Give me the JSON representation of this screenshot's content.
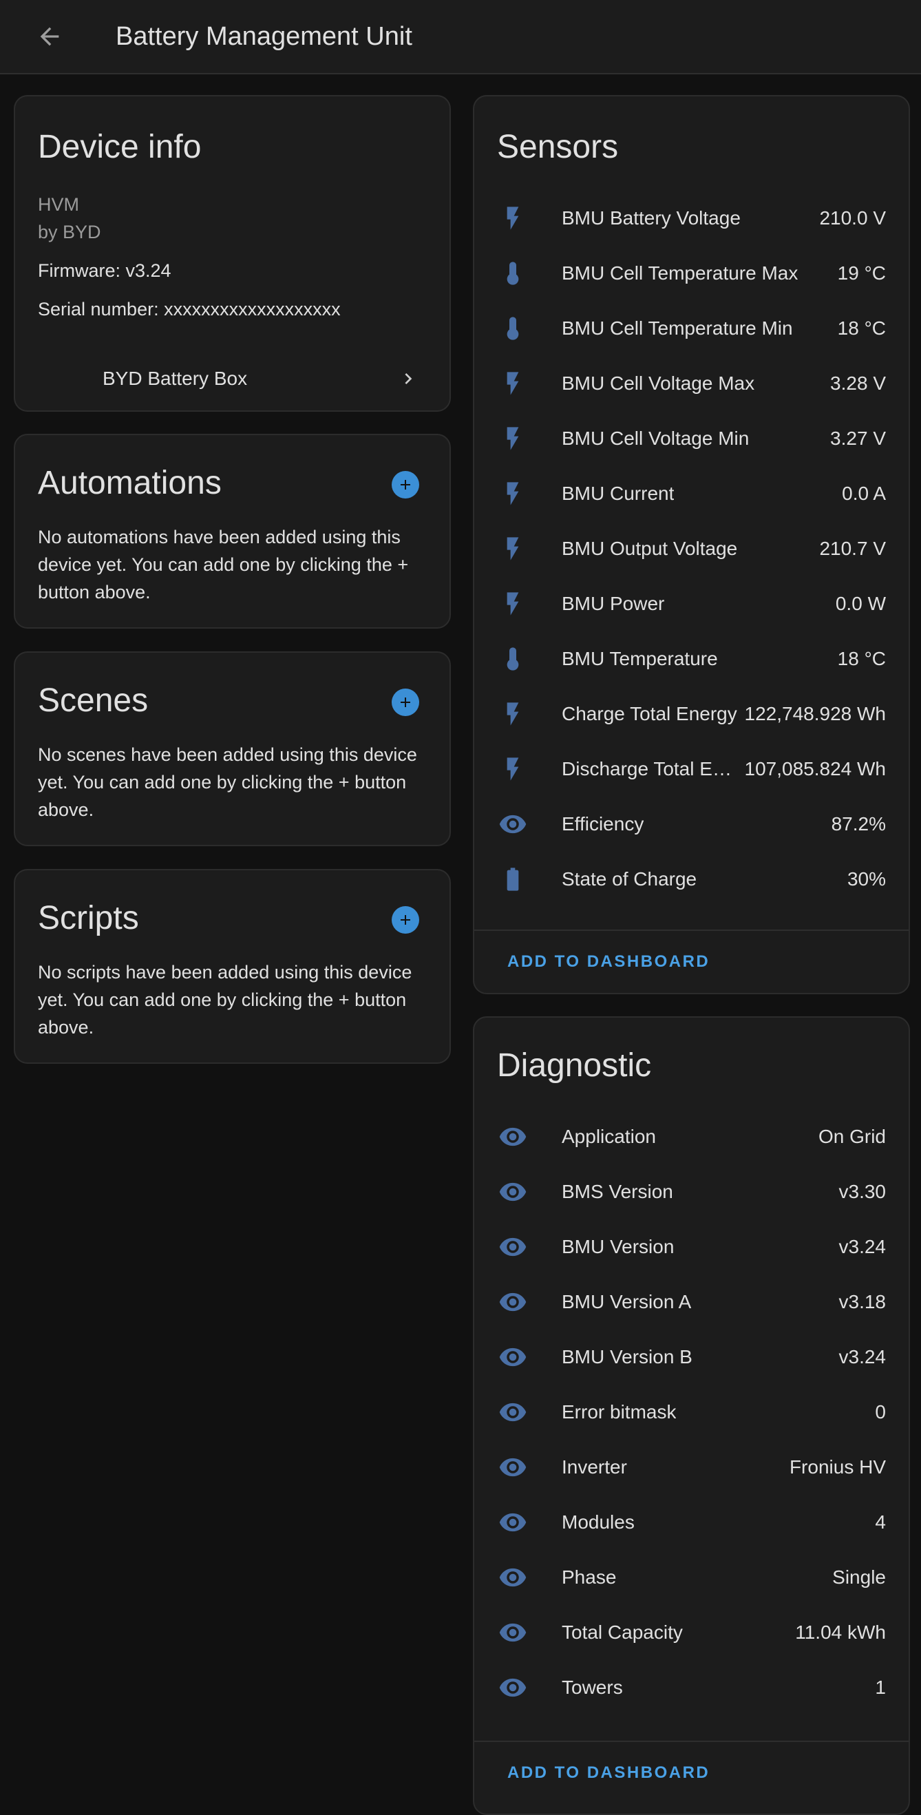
{
  "header": {
    "title": "Battery Management Unit"
  },
  "device_info": {
    "title": "Device info",
    "model": "HVM",
    "manufacturer": "by BYD",
    "firmware": "Firmware: v3.24",
    "serial": "Serial number: xxxxxxxxxxxxxxxxxxx",
    "link_label": "BYD Battery Box"
  },
  "automations": {
    "title": "Automations",
    "empty_text": "No automations have been added using this device yet. You can add one by clicking the + button above."
  },
  "scenes": {
    "title": "Scenes",
    "empty_text": "No scenes have been added using this device yet. You can add one by clicking the + button above."
  },
  "scripts": {
    "title": "Scripts",
    "empty_text": "No scripts have been added using this device yet. You can add one by clicking the + button above."
  },
  "sensors": {
    "title": "Sensors",
    "add_label": "ADD TO DASHBOARD",
    "items": [
      {
        "icon": "flash-icon",
        "name": "BMU Battery Voltage",
        "value": "210.0 V"
      },
      {
        "icon": "thermometer-icon",
        "name": "BMU Cell Temperature Max",
        "value": "19 °C"
      },
      {
        "icon": "thermometer-icon",
        "name": "BMU Cell Temperature Min",
        "value": "18 °C"
      },
      {
        "icon": "flash-icon",
        "name": "BMU Cell Voltage Max",
        "value": "3.28 V"
      },
      {
        "icon": "flash-icon",
        "name": "BMU Cell Voltage Min",
        "value": "3.27 V"
      },
      {
        "icon": "flash-icon",
        "name": "BMU Current",
        "value": "0.0 A"
      },
      {
        "icon": "flash-icon",
        "name": "BMU Output Voltage",
        "value": "210.7 V"
      },
      {
        "icon": "flash-icon",
        "name": "BMU Power",
        "value": "0.0 W"
      },
      {
        "icon": "thermometer-icon",
        "name": "BMU Temperature",
        "value": "18 °C"
      },
      {
        "icon": "flash-icon",
        "name": "Charge Total Energy",
        "value": "122,748.928 Wh"
      },
      {
        "icon": "flash-icon",
        "name": "Discharge Total Energy",
        "value": "107,085.824 Wh"
      },
      {
        "icon": "eye-icon",
        "name": "Efficiency",
        "value": "87.2%"
      },
      {
        "icon": "battery-icon",
        "name": "State of Charge",
        "value": "30%"
      }
    ]
  },
  "diagnostic": {
    "title": "Diagnostic",
    "add_label": "ADD TO DASHBOARD",
    "items": [
      {
        "icon": "eye-icon",
        "name": "Application",
        "value": "On Grid"
      },
      {
        "icon": "eye-icon",
        "name": "BMS Version",
        "value": "v3.30"
      },
      {
        "icon": "eye-icon",
        "name": "BMU Version",
        "value": "v3.24"
      },
      {
        "icon": "eye-icon",
        "name": "BMU Version A",
        "value": "v3.18"
      },
      {
        "icon": "eye-icon",
        "name": "BMU Version B",
        "value": "v3.24"
      },
      {
        "icon": "eye-icon",
        "name": "Error bitmask",
        "value": "0"
      },
      {
        "icon": "eye-icon",
        "name": "Inverter",
        "value": "Fronius HV"
      },
      {
        "icon": "eye-icon",
        "name": "Modules",
        "value": "4"
      },
      {
        "icon": "eye-icon",
        "name": "Phase",
        "value": "Single"
      },
      {
        "icon": "eye-icon",
        "name": "Total Capacity",
        "value": "11.04 kWh"
      },
      {
        "icon": "eye-icon",
        "name": "Towers",
        "value": "1"
      }
    ]
  },
  "colors": {
    "accent": "#3b8fd6",
    "icon": "#4a6fa5",
    "card": "#1c1c1c",
    "background": "#111111"
  }
}
